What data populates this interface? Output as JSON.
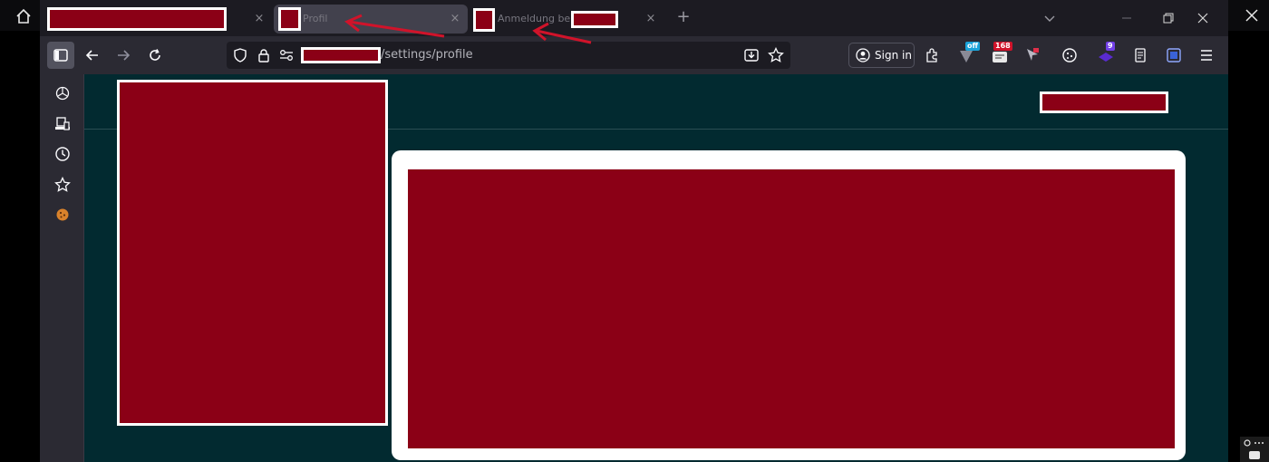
{
  "tabs": [
    {
      "title": "",
      "redacted": true,
      "active": false
    },
    {
      "title": "Profil",
      "redacted_favicon": true,
      "active": true
    },
    {
      "title": "Anmeldung bei",
      "redacted_favicon": true,
      "redacted_suffix": true,
      "active": false
    }
  ],
  "tab_close_glyph": "×",
  "new_tab_glyph": "+",
  "url": {
    "redacted_host": true,
    "path": "/settings/profile"
  },
  "toolbar": {
    "sign_in_label": "Sign in"
  },
  "extensions": {
    "badge_off": "off",
    "badge_count_1": "168",
    "badge_count_2": "9"
  },
  "colors": {
    "accent_red": "#8b0016",
    "content_bg": "#022a30",
    "chrome_bg": "#2b2a33",
    "arrow_red": "#d0132a"
  },
  "icons": [
    "home-icon",
    "close-icon",
    "sidebar-toggle-icon",
    "back-arrow-icon",
    "forward-arrow-icon",
    "reload-icon",
    "shield-icon",
    "lock-icon",
    "permissions-icon",
    "save-page-icon",
    "bookmark-star-icon",
    "account-icon",
    "extensions-icon",
    "chatgpt-icon",
    "synced-tabs-icon",
    "history-icon",
    "bookmarks-icon",
    "cookie-icon",
    "menu-icon"
  ]
}
